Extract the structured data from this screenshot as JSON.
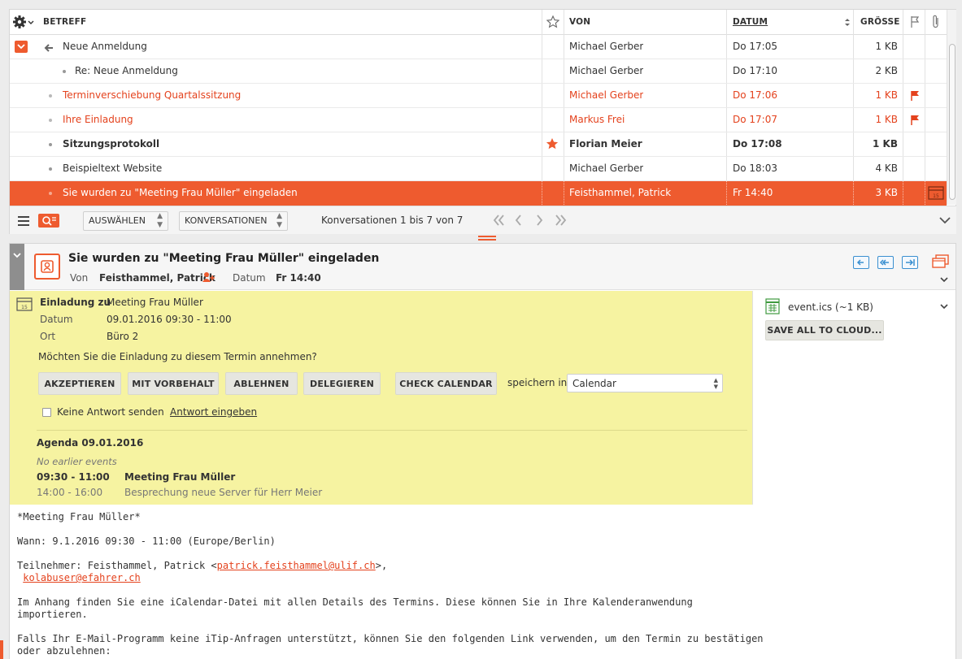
{
  "list": {
    "columns": {
      "subject": "BETREFF",
      "from": "VON",
      "date": "DATUM",
      "size": "GRÖSSE"
    },
    "rows": [
      {
        "subject": "Neue Anmeldung",
        "from": "Michael Gerber",
        "date": "Do 17:05",
        "size": "1 KB",
        "indent": 0,
        "thread_parent": true
      },
      {
        "subject": "Re: Neue Anmeldung",
        "from": "Michael Gerber",
        "date": "Do 17:10",
        "size": "2 KB",
        "indent": 1
      },
      {
        "subject": "Terminverschiebung Quartalssitzung",
        "from": "Michael Gerber",
        "date": "Do 17:06",
        "size": "1 KB",
        "indent": 0,
        "flagged": true
      },
      {
        "subject": "Ihre Einladung",
        "from": "Markus Frei",
        "date": "Do 17:07",
        "size": "1 KB",
        "indent": 0,
        "flagged": true
      },
      {
        "subject": "Sitzungsprotokoll",
        "from": "Florian Meier",
        "date": "Do 17:08",
        "size": "1 KB",
        "indent": 0,
        "unread": true,
        "starred": true
      },
      {
        "subject": "Beispieltext Website",
        "from": "Michael Gerber",
        "date": "Do 18:03",
        "size": "4 KB",
        "indent": 0
      },
      {
        "subject": "Sie wurden zu \"Meeting Frau Müller\" eingeladen",
        "from": "Feisthammel, Patrick",
        "date": "Fr 14:40",
        "size": "3 KB",
        "indent": 0,
        "selected": true
      }
    ],
    "footer": {
      "select_label": "AUSWÄHLEN",
      "threads_label": "KONVERSATIONEN",
      "count_text": "Konversationen 1 bis 7 von 7"
    }
  },
  "message": {
    "subject": "Sie wurden zu \"Meeting Frau Müller\" eingeladen",
    "from_label": "Von",
    "from_name": "Feisthammel, Patrick",
    "date_label": "Datum",
    "date_value": "Fr 14:40"
  },
  "invitation": {
    "title_label": "Einladung zu",
    "title_value": "Meeting Frau Müller",
    "date_label": "Datum",
    "date_value": "09.01.2016 09:30 - 11:00",
    "location_label": "Ort",
    "location_value": "Büro 2",
    "question": "Möchten Sie die Einladung zu diesem Termin annehmen?",
    "buttons": {
      "accept": "AKZEPTIEREN",
      "tentative": "MIT VORBEHALT",
      "decline": "ABLEHNEN",
      "delegate": "DELEGIEREN",
      "check_calendar": "CHECK CALENDAR"
    },
    "save_in_label": "speichern in",
    "calendar_selected": "Calendar",
    "no_reply_label": "Keine Antwort senden",
    "reply_link": "Antwort eingeben",
    "agenda_title": "Agenda 09.01.2016",
    "no_earlier": "No earlier events",
    "agenda_items": [
      {
        "time": "09:30 - 11:00",
        "title": "Meeting Frau Müller",
        "current": true
      },
      {
        "time": "14:00 - 16:00",
        "title": "Besprechung neue Server für Herr Meier",
        "current": false
      }
    ]
  },
  "attachments": {
    "file_name": "event.ics (~1 KB)",
    "save_all": "SAVE ALL TO CLOUD..."
  },
  "body": {
    "line1": "*Meeting Frau Müller*",
    "line2": "Wann: 9.1.2016 09:30 - 11:00 (Europe/Berlin)",
    "line3_prefix": "Teilnehmer: Feisthammel, Patrick <",
    "email1": "patrick.feisthammel@ulif.ch",
    "line3_suffix": ">,",
    "email2": "kolabuser@efahrer.ch",
    "line4a": "Im Anhang finden Sie eine iCalendar-Datei mit allen Details des Termins. Diese können Sie in Ihre Kalenderanwendung",
    "line4b": "importieren.",
    "line5a": "Falls Ihr E-Mail-Programm keine iTip-Anfragen unterstützt, können Sie den folgenden Link verwenden, um den Termin zu bestätigen",
    "line5b": "oder abzulehnen:"
  },
  "colors": {
    "accent": "#ee5b2f",
    "flag": "#e4421d",
    "itip_background": "#f6f3a1",
    "action_blue": "#3a8fd0"
  }
}
